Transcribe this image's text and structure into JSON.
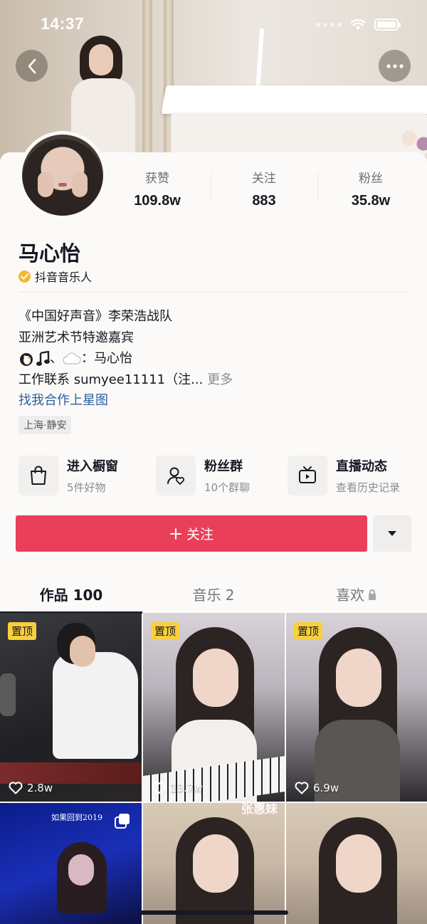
{
  "status_bar": {
    "time": "14:37"
  },
  "header": {
    "back_icon": "chevron-left-icon",
    "more_icon": "ellipsis-icon"
  },
  "profile": {
    "name": "马心怡",
    "verified_label": "抖音音乐人",
    "stats": [
      {
        "label": "获赞",
        "value": "109.8w"
      },
      {
        "label": "关注",
        "value": "883"
      },
      {
        "label": "粉丝",
        "value": "35.8w"
      }
    ],
    "bio": {
      "line1": "《中国好声音》李荣浩战队",
      "line2": "亚洲艺术节特邀嘉宾",
      "line3_suffix": "、",
      "line3_name": "马心怡",
      "line4": "工作联系 sumyee11111（注...",
      "more": "更多",
      "link": "找我合作上星图"
    },
    "location": "上海·静安"
  },
  "shortcuts": [
    {
      "title": "进入橱窗",
      "subtitle": "5件好物",
      "icon": "shopping-bag-icon"
    },
    {
      "title": "粉丝群",
      "subtitle": "10个群聊",
      "icon": "user-heart-icon"
    },
    {
      "title": "直播动态",
      "subtitle": "查看历史记录",
      "icon": "tv-icon"
    }
  ],
  "actions": {
    "follow_label": "关注",
    "dropdown_icon": "caret-down-icon"
  },
  "tabs": [
    {
      "label": "作品 100",
      "active": true
    },
    {
      "label": "音乐 2",
      "active": false
    },
    {
      "label": "喜欢",
      "active": false,
      "locked": true
    }
  ],
  "videos": [
    {
      "pinned": "置顶",
      "likes": "2.8w"
    },
    {
      "pinned": "置顶",
      "likes": "13.7w"
    },
    {
      "pinned": "置顶",
      "likes": "6.9w"
    },
    {
      "overlay_text": "如果回到2019"
    },
    {
      "overlay_text": "张惠妹"
    },
    {
      "overlay_text": ""
    }
  ],
  "colors": {
    "accent": "#ea3f58",
    "link": "#2c5f9e",
    "pin": "#f8cf3d",
    "verified": "#f4b830"
  }
}
